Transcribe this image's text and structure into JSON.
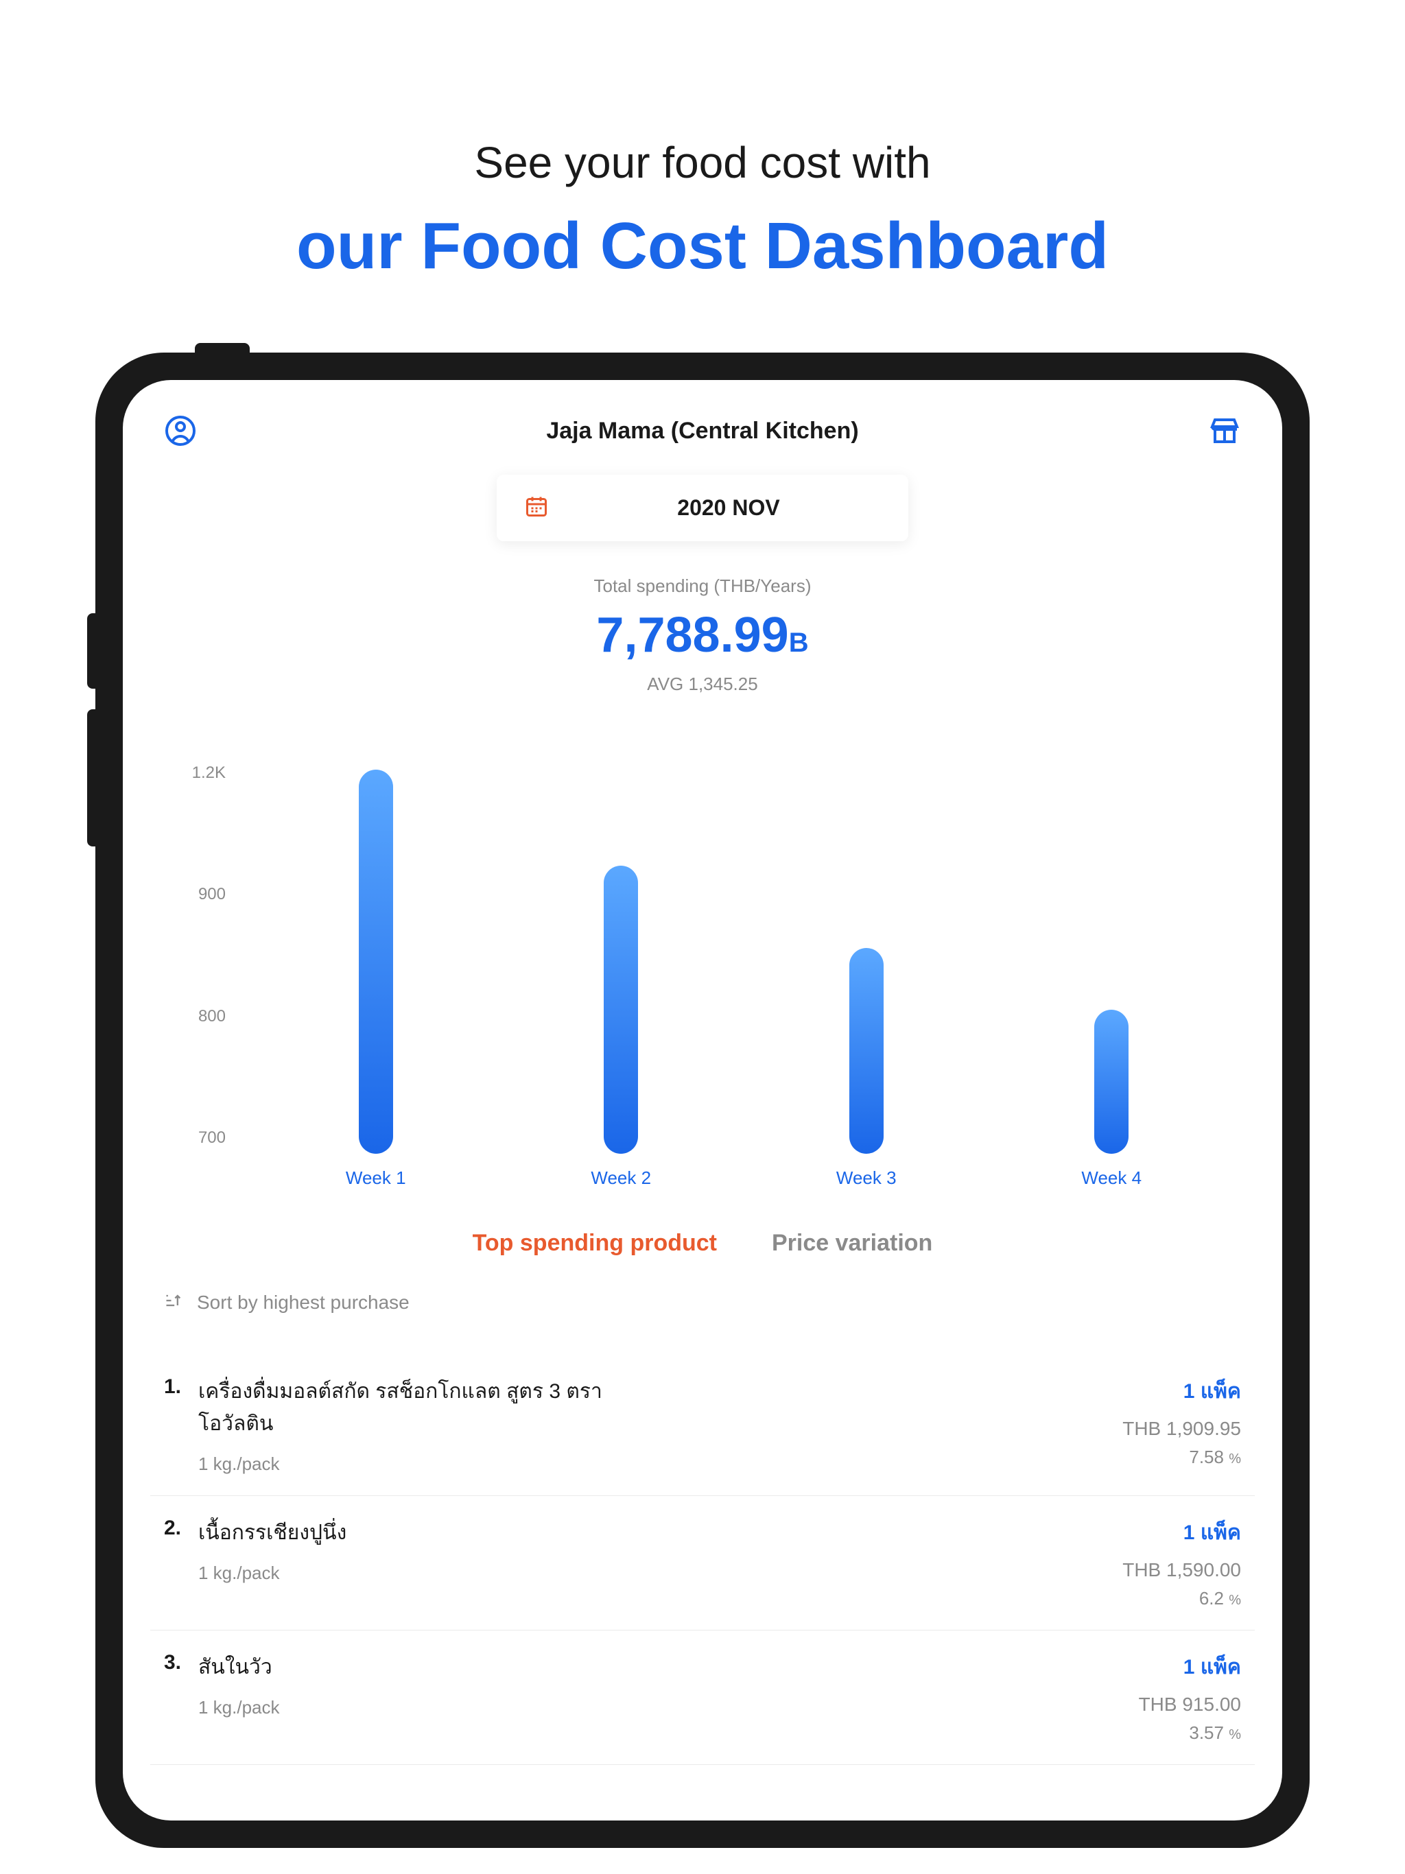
{
  "promo": {
    "line1": "See your food cost with",
    "line2": "our Food Cost Dashboard"
  },
  "header": {
    "title": "Jaja Mama (Central Kitchen)"
  },
  "dateSelector": {
    "label": "2020 NOV"
  },
  "spending": {
    "label": "Total spending (THB/Years)",
    "amount": "7,788.99",
    "currency": "B",
    "avg": "AVG 1,345.25"
  },
  "chart_data": {
    "type": "bar",
    "categories": [
      "Week 1",
      "Week 2",
      "Week 3",
      "Week 4"
    ],
    "values": [
      1200,
      960,
      850,
      810
    ],
    "y_ticks": [
      "1.2K",
      "900",
      "800",
      "700"
    ],
    "ylim": [
      700,
      1200
    ]
  },
  "tabs": {
    "active": "Top spending product",
    "inactive": "Price variation"
  },
  "sort": {
    "label": "Sort by highest purchase"
  },
  "products": [
    {
      "num": "1.",
      "name": "เครื่องดื่มมอลต์สกัด รสช็อกโกแลต สูตร 3 ตราโอวัลติน",
      "unit": "1 kg./pack",
      "qty": "1 แพ็ค",
      "price": "THB 1,909.95",
      "pct": "7.58",
      "pctSuffix": "%"
    },
    {
      "num": "2.",
      "name": "เนื้อกรรเชียงปูนึ่ง",
      "unit": "1 kg./pack",
      "qty": "1 แพ็ค",
      "price": "THB 1,590.00",
      "pct": "6.2",
      "pctSuffix": "%"
    },
    {
      "num": "3.",
      "name": "สันในวัว",
      "unit": "1 kg./pack",
      "qty": "1 แพ็ค",
      "price": "THB 915.00",
      "pct": "3.57",
      "pctSuffix": "%"
    }
  ]
}
